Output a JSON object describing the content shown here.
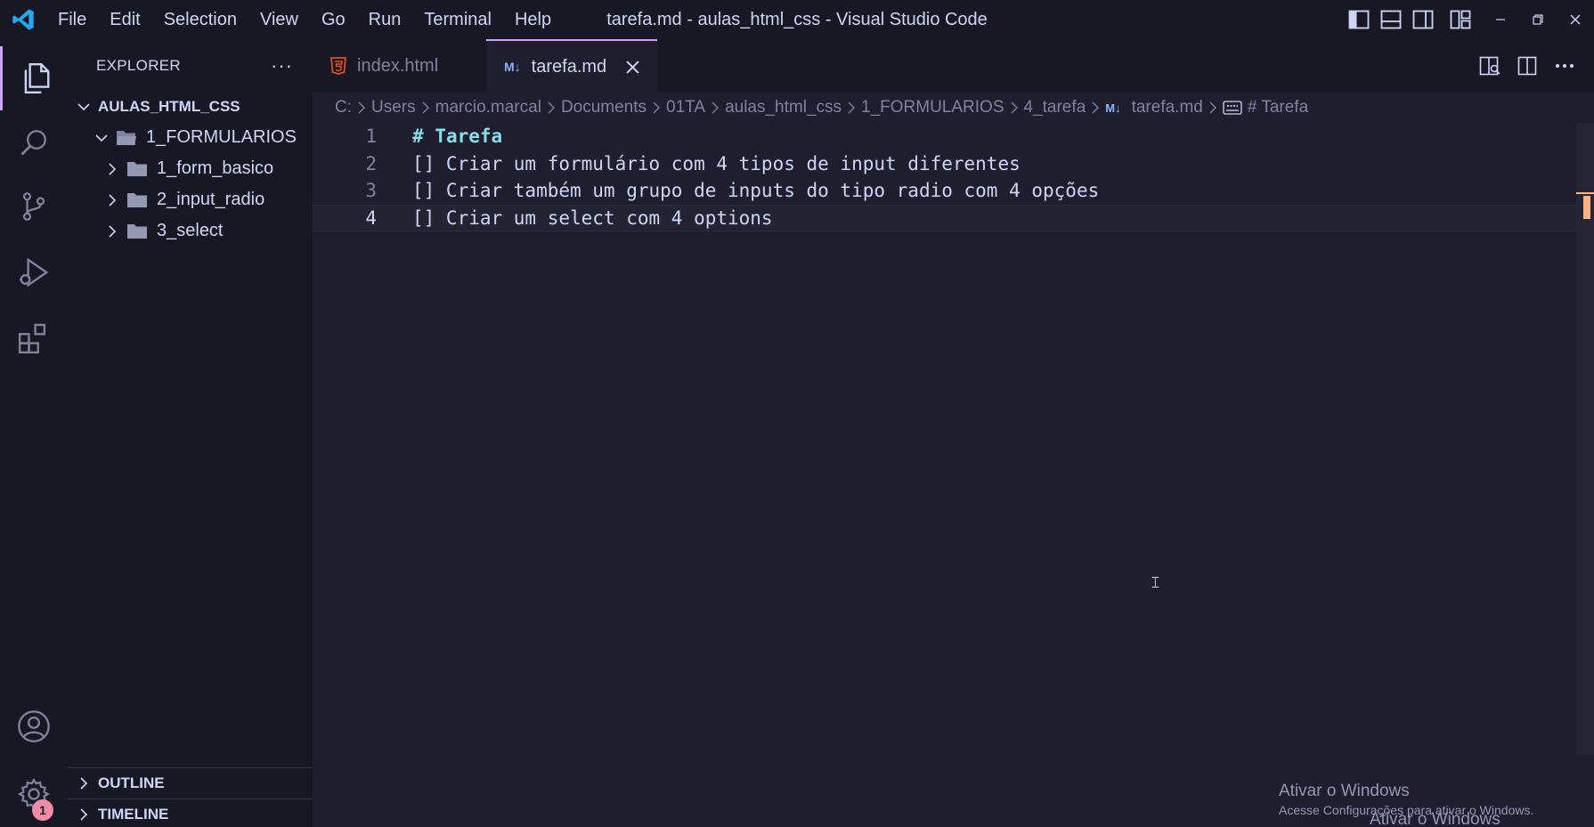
{
  "menu": [
    "File",
    "Edit",
    "Selection",
    "View",
    "Go",
    "Run",
    "Terminal",
    "Help"
  ],
  "window_title": "tarefa.md - aulas_html_css - Visual Studio Code",
  "sidebar": {
    "title": "EXPLORER",
    "more": "···",
    "root": "AULAS_HTML_CSS",
    "folder": "1_FORMULARIOS",
    "subfolders": [
      "1_form_basico",
      "2_input_radio",
      "3_select"
    ],
    "outline": "OUTLINE",
    "timeline": "TIMELINE"
  },
  "tabs": [
    {
      "label": "index.html",
      "icon": "html5-icon",
      "active": false
    },
    {
      "label": "tarefa.md",
      "icon": "markdown-icon",
      "active": true
    }
  ],
  "markdown_icon_text": "M↓",
  "breadcrumb": {
    "segments": [
      "C:",
      "Users",
      "marcio.marcal",
      "Documents",
      "01TA",
      "aulas_html_css",
      "1_FORMULARIOS",
      "4_tarefa"
    ],
    "file": "tarefa.md",
    "symbol": "# Tarefa"
  },
  "editor": {
    "line_numbers": [
      "1",
      "2",
      "3",
      "4"
    ],
    "heading_hash": "#",
    "heading_text": "Tarefa",
    "lines": [
      "[] Criar um formulário com 4 tipos de input diferentes",
      "[] Criar também um grupo de inputs do tipo radio com 4 opções",
      "[] Criar um select com 4 options"
    ]
  },
  "accounts_badge": "1",
  "watermark": {
    "title": "Ativar o Windows",
    "subtitle": "Acesse Configurações para ativar o Windows.",
    "title_repeat": "Ativar o Windows"
  },
  "colors": {
    "accent": "#cba6f7",
    "vscode_blue": "#23a9f2",
    "html_orange": "#e44d26",
    "heading_cyan": "#89dceb"
  }
}
